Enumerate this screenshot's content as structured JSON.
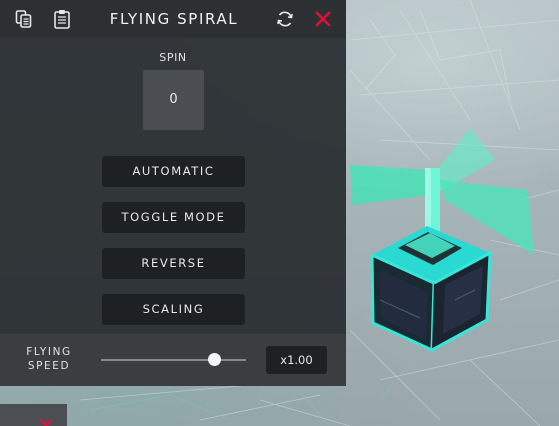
{
  "panel": {
    "title": "FLYING SPIRAL",
    "icons": [
      "copy-icon",
      "paste-icon",
      "refresh-icon",
      "close-icon"
    ],
    "spin": {
      "label": "SPIN",
      "value": "0"
    },
    "buttons": [
      {
        "label": "AUTOMATIC"
      },
      {
        "label": "TOGGLE MODE"
      },
      {
        "label": "REVERSE"
      },
      {
        "label": "SCALING"
      }
    ],
    "speed": {
      "label": "FLYING SPEED",
      "value": "x1.00",
      "slider_fraction": 0.78
    }
  },
  "colors": {
    "close_accent": "#e0103a",
    "panel_bg": "#2b2f32",
    "button_bg": "#1e2124",
    "object_teal": "#2ff0b8"
  }
}
